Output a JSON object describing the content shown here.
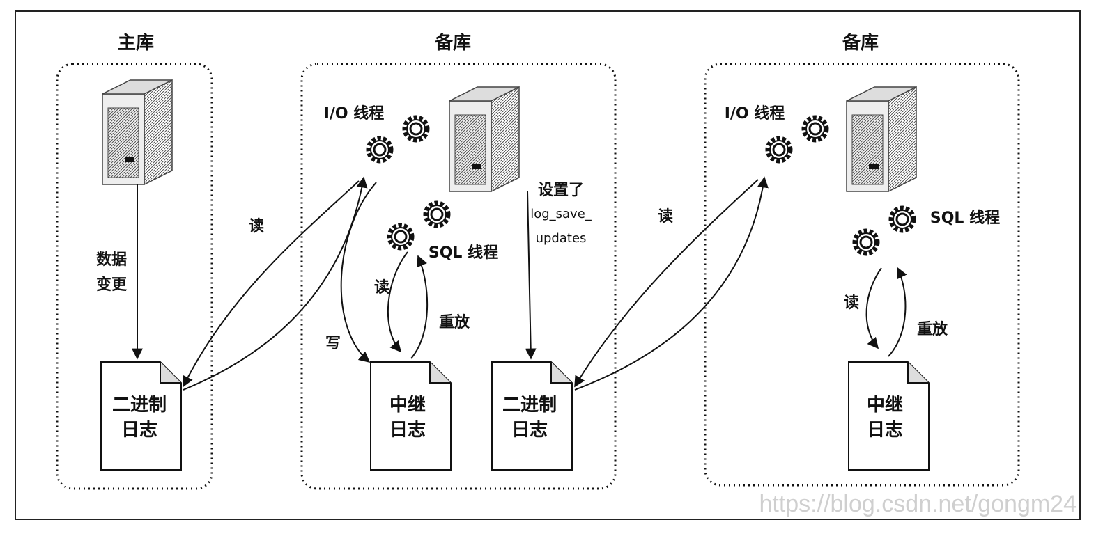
{
  "sections": {
    "master": {
      "title": "主库",
      "data_change": [
        "数据",
        "变更"
      ],
      "binlog": [
        "二进制",
        "日志"
      ]
    },
    "replica1": {
      "title": "备库",
      "io_thread": "I/O 线程",
      "sql_thread": "SQL 线程",
      "relay_log": [
        "中继",
        "日志"
      ],
      "binlog": [
        "二进制",
        "日志"
      ],
      "setting": [
        "设置了",
        "log_save_",
        "updates"
      ],
      "write": "写",
      "read": "读",
      "replay": "重放"
    },
    "replica2": {
      "title": "备库",
      "io_thread": "I/O 线程",
      "sql_thread": "SQL 线程",
      "relay_log": [
        "中继",
        "日志"
      ],
      "read": "读",
      "replay": "重放"
    }
  },
  "arrows": {
    "read_from_master": "读",
    "read_from_replica1": "读"
  },
  "watermark": "https://blog.csdn.net/gongm24"
}
